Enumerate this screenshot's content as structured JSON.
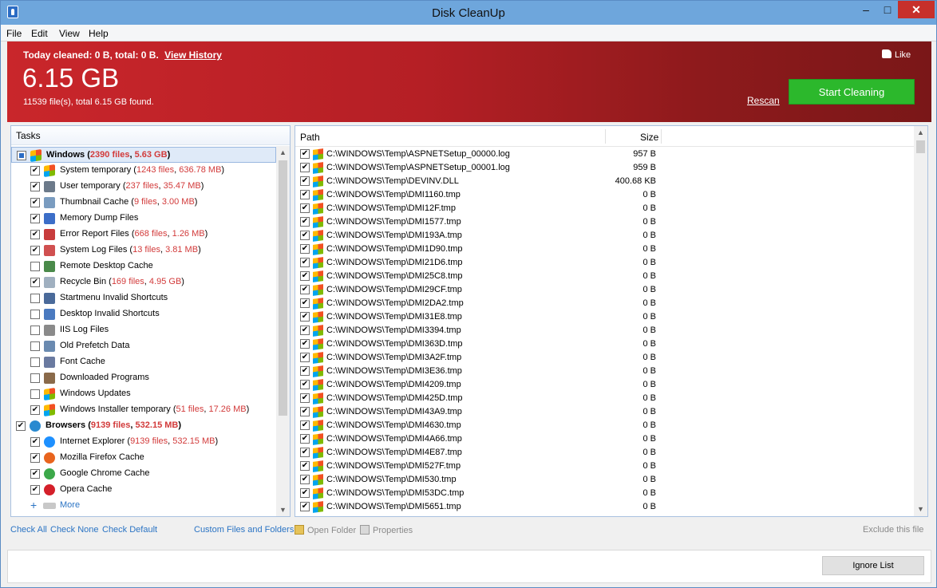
{
  "window": {
    "title": "Disk CleanUp",
    "minimize": "–",
    "maximize": "□",
    "close": "✕"
  },
  "menu": [
    "File",
    "Edit",
    "View",
    "Help"
  ],
  "banner": {
    "today_text": "Today cleaned: 0 B, total: 0 B.",
    "view_history": "View History",
    "total_size": "6.15 GB",
    "found_text": "11539 file(s), total 6.15 GB found.",
    "like": "Like",
    "rescan": "Rescan",
    "start_cleaning": "Start Cleaning"
  },
  "tasks": {
    "header": "Tasks",
    "rows": [
      {
        "group": true,
        "checked": "partial",
        "name": "Windows",
        "files": "2390 files",
        "size": "5.63 GB",
        "icon": "windows-icon",
        "color": "#f0a020"
      },
      {
        "group": false,
        "checked": true,
        "name": "System temporary",
        "files": "1243 files",
        "size": "636.78 MB",
        "icon": "windows-temp-icon",
        "color": "#f0a020"
      },
      {
        "group": false,
        "checked": true,
        "name": "User temporary",
        "files": "237 files",
        "size": "35.47 MB",
        "icon": "user-temp-icon",
        "color": "#6c7a8a"
      },
      {
        "group": false,
        "checked": true,
        "name": "Thumbnail Cache",
        "files": "9 files",
        "size": "3.00 MB",
        "icon": "thumbnail-icon",
        "color": "#7a9cc0"
      },
      {
        "group": false,
        "checked": true,
        "name": "Memory Dump Files",
        "files": "",
        "size": "",
        "icon": "memory-dump-icon",
        "color": "#3c6ec8"
      },
      {
        "group": false,
        "checked": true,
        "name": "Error Report Files",
        "files": "668 files",
        "size": "1.26 MB",
        "icon": "error-report-icon",
        "color": "#c83c3c"
      },
      {
        "group": false,
        "checked": true,
        "name": "System Log Files",
        "files": "13 files",
        "size": "3.81 MB",
        "icon": "system-log-icon",
        "color": "#d05050"
      },
      {
        "group": false,
        "checked": false,
        "name": "Remote Desktop Cache",
        "files": "",
        "size": "",
        "icon": "remote-desktop-icon",
        "color": "#4a8a4a"
      },
      {
        "group": false,
        "checked": true,
        "name": "Recycle Bin",
        "files": "169 files",
        "size": "4.95 GB",
        "icon": "recycle-bin-icon",
        "color": "#a0b0c0"
      },
      {
        "group": false,
        "checked": false,
        "name": "Startmenu Invalid Shortcuts",
        "files": "",
        "size": "",
        "icon": "startmenu-icon",
        "color": "#4a6a9a"
      },
      {
        "group": false,
        "checked": false,
        "name": "Desktop Invalid Shortcuts",
        "files": "",
        "size": "",
        "icon": "desktop-shortcut-icon",
        "color": "#4a7ac0"
      },
      {
        "group": false,
        "checked": false,
        "name": "IIS Log Files",
        "files": "",
        "size": "",
        "icon": "iis-log-icon",
        "color": "#8a8a8a"
      },
      {
        "group": false,
        "checked": false,
        "name": "Old Prefetch Data",
        "files": "",
        "size": "",
        "icon": "prefetch-icon",
        "color": "#6a8ab0"
      },
      {
        "group": false,
        "checked": false,
        "name": "Font Cache",
        "files": "",
        "size": "",
        "icon": "font-cache-icon",
        "color": "#6a7aa0"
      },
      {
        "group": false,
        "checked": false,
        "name": "Downloaded Programs",
        "files": "",
        "size": "",
        "icon": "downloaded-programs-icon",
        "color": "#8a6a4a"
      },
      {
        "group": false,
        "checked": false,
        "name": "Windows Updates",
        "files": "",
        "size": "",
        "icon": "windows-updates-icon",
        "color": "#f0a020"
      },
      {
        "group": false,
        "checked": true,
        "name": "Windows Installer temporary",
        "files": "51 files",
        "size": "17.26 MB",
        "icon": "installer-icon",
        "color": "#f0a020"
      },
      {
        "group": true,
        "checked": true,
        "name": "Browsers",
        "files": "9139 files",
        "size": "532.15 MB",
        "icon": "globe-icon",
        "color": "#2a8ad0"
      },
      {
        "group": false,
        "checked": true,
        "name": "Internet Explorer",
        "files": "9139 files",
        "size": "532.15 MB",
        "icon": "internet-explorer-icon",
        "color": "#1e90ff"
      },
      {
        "group": false,
        "checked": true,
        "name": "Mozilla Firefox Cache",
        "files": "",
        "size": "",
        "icon": "firefox-icon",
        "color": "#e8641e"
      },
      {
        "group": false,
        "checked": true,
        "name": "Google Chrome Cache",
        "files": "",
        "size": "",
        "icon": "chrome-icon",
        "color": "#3ca84a"
      },
      {
        "group": false,
        "checked": true,
        "name": "Opera Cache",
        "files": "",
        "size": "",
        "icon": "opera-icon",
        "color": "#d4202a"
      }
    ],
    "more_label": "More"
  },
  "filelist": {
    "col_path": "Path",
    "col_size": "Size",
    "rows": [
      {
        "path": "C:\\WINDOWS\\Temp\\ASPNETSetup_00000.log",
        "size": "957 B"
      },
      {
        "path": "C:\\WINDOWS\\Temp\\ASPNETSetup_00001.log",
        "size": "959 B"
      },
      {
        "path": "C:\\WINDOWS\\Temp\\DEVINV.DLL",
        "size": "400.68 KB"
      },
      {
        "path": "C:\\WINDOWS\\Temp\\DMI1160.tmp",
        "size": "0 B"
      },
      {
        "path": "C:\\WINDOWS\\Temp\\DMI12F.tmp",
        "size": "0 B"
      },
      {
        "path": "C:\\WINDOWS\\Temp\\DMI1577.tmp",
        "size": "0 B"
      },
      {
        "path": "C:\\WINDOWS\\Temp\\DMI193A.tmp",
        "size": "0 B"
      },
      {
        "path": "C:\\WINDOWS\\Temp\\DMI1D90.tmp",
        "size": "0 B"
      },
      {
        "path": "C:\\WINDOWS\\Temp\\DMI21D6.tmp",
        "size": "0 B"
      },
      {
        "path": "C:\\WINDOWS\\Temp\\DMI25C8.tmp",
        "size": "0 B"
      },
      {
        "path": "C:\\WINDOWS\\Temp\\DMI29CF.tmp",
        "size": "0 B"
      },
      {
        "path": "C:\\WINDOWS\\Temp\\DMI2DA2.tmp",
        "size": "0 B"
      },
      {
        "path": "C:\\WINDOWS\\Temp\\DMI31E8.tmp",
        "size": "0 B"
      },
      {
        "path": "C:\\WINDOWS\\Temp\\DMI3394.tmp",
        "size": "0 B"
      },
      {
        "path": "C:\\WINDOWS\\Temp\\DMI363D.tmp",
        "size": "0 B"
      },
      {
        "path": "C:\\WINDOWS\\Temp\\DMI3A2F.tmp",
        "size": "0 B"
      },
      {
        "path": "C:\\WINDOWS\\Temp\\DMI3E36.tmp",
        "size": "0 B"
      },
      {
        "path": "C:\\WINDOWS\\Temp\\DMI4209.tmp",
        "size": "0 B"
      },
      {
        "path": "C:\\WINDOWS\\Temp\\DMI425D.tmp",
        "size": "0 B"
      },
      {
        "path": "C:\\WINDOWS\\Temp\\DMI43A9.tmp",
        "size": "0 B"
      },
      {
        "path": "C:\\WINDOWS\\Temp\\DMI4630.tmp",
        "size": "0 B"
      },
      {
        "path": "C:\\WINDOWS\\Temp\\DMI4A66.tmp",
        "size": "0 B"
      },
      {
        "path": "C:\\WINDOWS\\Temp\\DMI4E87.tmp",
        "size": "0 B"
      },
      {
        "path": "C:\\WINDOWS\\Temp\\DMI527F.tmp",
        "size": "0 B"
      },
      {
        "path": "C:\\WINDOWS\\Temp\\DMI530.tmp",
        "size": "0 B"
      },
      {
        "path": "C:\\WINDOWS\\Temp\\DMI53DC.tmp",
        "size": "0 B"
      },
      {
        "path": "C:\\WINDOWS\\Temp\\DMI5651.tmp",
        "size": "0 B"
      }
    ]
  },
  "actions": {
    "check_all": "Check All",
    "check_none": "Check None",
    "check_default": "Check Default",
    "custom_files": "Custom Files and Folders",
    "open_folder": "Open Folder",
    "properties": "Properties",
    "exclude": "Exclude this file"
  },
  "bottom": {
    "ignore_list": "Ignore List"
  }
}
